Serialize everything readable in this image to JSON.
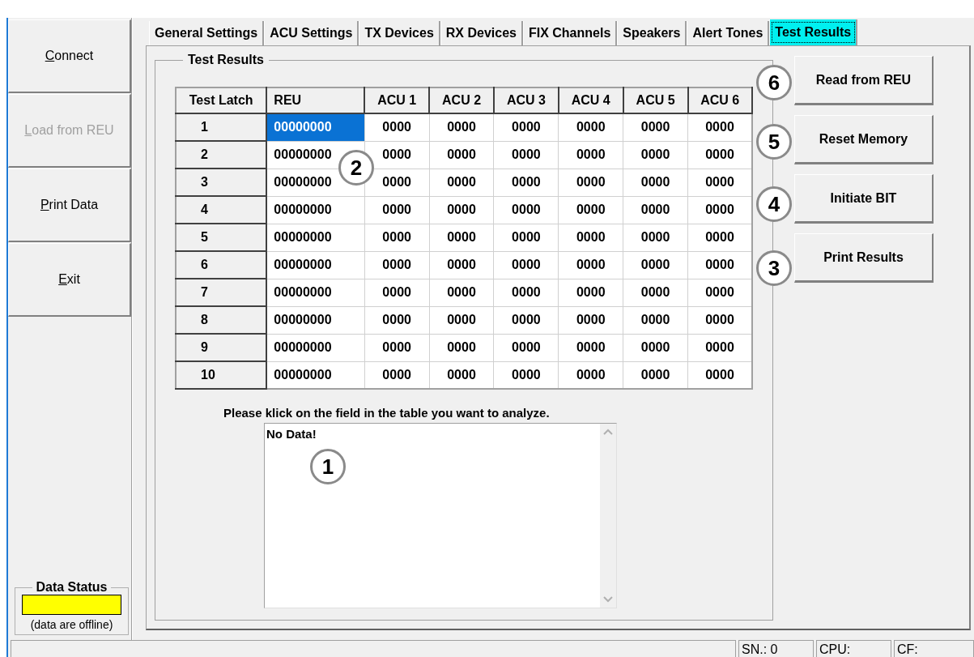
{
  "sidebar": {
    "buttons": [
      {
        "label": "Connect",
        "disabled": false
      },
      {
        "label": "Load from REU",
        "disabled": true
      },
      {
        "label": "Print Data",
        "disabled": false
      },
      {
        "label": "Exit",
        "disabled": false
      }
    ]
  },
  "data_status": {
    "title": "Data Status",
    "online": false,
    "note": "(data are offline)"
  },
  "tabs": [
    {
      "label": "General Settings",
      "selected": false
    },
    {
      "label": "ACU Settings",
      "selected": false
    },
    {
      "label": "TX Devices",
      "selected": false
    },
    {
      "label": "RX Devices",
      "selected": false
    },
    {
      "label": "FIX Channels",
      "selected": false
    },
    {
      "label": "Speakers",
      "selected": false
    },
    {
      "label": "Alert Tones",
      "selected": false
    },
    {
      "label": "Test Results",
      "selected": true
    }
  ],
  "group_title": "Test Results",
  "table": {
    "columns": [
      "Test Latch",
      "REU",
      "ACU 1",
      "ACU 2",
      "ACU 3",
      "ACU 4",
      "ACU 5",
      "ACU 6"
    ],
    "rows": [
      {
        "cells": [
          {
            "value": "1",
            "selected": false
          },
          {
            "value": "00000000",
            "selected": true
          },
          {
            "value": "0000",
            "selected": false
          },
          {
            "value": "0000",
            "selected": false
          },
          {
            "value": "0000",
            "selected": false
          },
          {
            "value": "0000",
            "selected": false
          },
          {
            "value": "0000",
            "selected": false
          },
          {
            "value": "0000",
            "selected": false
          }
        ]
      },
      {
        "cells": [
          {
            "value": "2",
            "selected": false
          },
          {
            "value": "00000000",
            "selected": false
          },
          {
            "value": "0000",
            "selected": false
          },
          {
            "value": "0000",
            "selected": false
          },
          {
            "value": "0000",
            "selected": false
          },
          {
            "value": "0000",
            "selected": false
          },
          {
            "value": "0000",
            "selected": false
          },
          {
            "value": "0000",
            "selected": false
          }
        ]
      },
      {
        "cells": [
          {
            "value": "3",
            "selected": false
          },
          {
            "value": "00000000",
            "selected": false
          },
          {
            "value": "0000",
            "selected": false
          },
          {
            "value": "0000",
            "selected": false
          },
          {
            "value": "0000",
            "selected": false
          },
          {
            "value": "0000",
            "selected": false
          },
          {
            "value": "0000",
            "selected": false
          },
          {
            "value": "0000",
            "selected": false
          }
        ]
      },
      {
        "cells": [
          {
            "value": "4",
            "selected": false
          },
          {
            "value": "00000000",
            "selected": false
          },
          {
            "value": "0000",
            "selected": false
          },
          {
            "value": "0000",
            "selected": false
          },
          {
            "value": "0000",
            "selected": false
          },
          {
            "value": "0000",
            "selected": false
          },
          {
            "value": "0000",
            "selected": false
          },
          {
            "value": "0000",
            "selected": false
          }
        ]
      },
      {
        "cells": [
          {
            "value": "5",
            "selected": false
          },
          {
            "value": "00000000",
            "selected": false
          },
          {
            "value": "0000",
            "selected": false
          },
          {
            "value": "0000",
            "selected": false
          },
          {
            "value": "0000",
            "selected": false
          },
          {
            "value": "0000",
            "selected": false
          },
          {
            "value": "0000",
            "selected": false
          },
          {
            "value": "0000",
            "selected": false
          }
        ]
      },
      {
        "cells": [
          {
            "value": "6",
            "selected": false
          },
          {
            "value": "00000000",
            "selected": false
          },
          {
            "value": "0000",
            "selected": false
          },
          {
            "value": "0000",
            "selected": false
          },
          {
            "value": "0000",
            "selected": false
          },
          {
            "value": "0000",
            "selected": false
          },
          {
            "value": "0000",
            "selected": false
          },
          {
            "value": "0000",
            "selected": false
          }
        ]
      },
      {
        "cells": [
          {
            "value": "7",
            "selected": false
          },
          {
            "value": "00000000",
            "selected": false
          },
          {
            "value": "0000",
            "selected": false
          },
          {
            "value": "0000",
            "selected": false
          },
          {
            "value": "0000",
            "selected": false
          },
          {
            "value": "0000",
            "selected": false
          },
          {
            "value": "0000",
            "selected": false
          },
          {
            "value": "0000",
            "selected": false
          }
        ]
      },
      {
        "cells": [
          {
            "value": "8",
            "selected": false
          },
          {
            "value": "00000000",
            "selected": false
          },
          {
            "value": "0000",
            "selected": false
          },
          {
            "value": "0000",
            "selected": false
          },
          {
            "value": "0000",
            "selected": false
          },
          {
            "value": "0000",
            "selected": false
          },
          {
            "value": "0000",
            "selected": false
          },
          {
            "value": "0000",
            "selected": false
          }
        ]
      },
      {
        "cells": [
          {
            "value": "9",
            "selected": false
          },
          {
            "value": "00000000",
            "selected": false
          },
          {
            "value": "0000",
            "selected": false
          },
          {
            "value": "0000",
            "selected": false
          },
          {
            "value": "0000",
            "selected": false
          },
          {
            "value": "0000",
            "selected": false
          },
          {
            "value": "0000",
            "selected": false
          },
          {
            "value": "0000",
            "selected": false
          }
        ]
      },
      {
        "cells": [
          {
            "value": "10",
            "selected": false
          },
          {
            "value": "00000000",
            "selected": false
          },
          {
            "value": "0000",
            "selected": false
          },
          {
            "value": "0000",
            "selected": false
          },
          {
            "value": "0000",
            "selected": false
          },
          {
            "value": "0000",
            "selected": false
          },
          {
            "value": "0000",
            "selected": false
          },
          {
            "value": "0000",
            "selected": false
          }
        ]
      }
    ]
  },
  "instruction": "Please klick on the field in the table you want to analyze.",
  "analysis_text": "No Data!",
  "actions": [
    "Read from REU",
    "Reset Memory",
    "Initiate BIT",
    "Print Results"
  ],
  "callouts": [
    {
      "number": "6"
    },
    {
      "number": "5"
    },
    {
      "number": "2"
    },
    {
      "number": "4"
    },
    {
      "number": "3"
    },
    {
      "number": "1"
    }
  ],
  "status_bar": [
    "SN.: 0",
    "CPU:",
    "CF:"
  ]
}
